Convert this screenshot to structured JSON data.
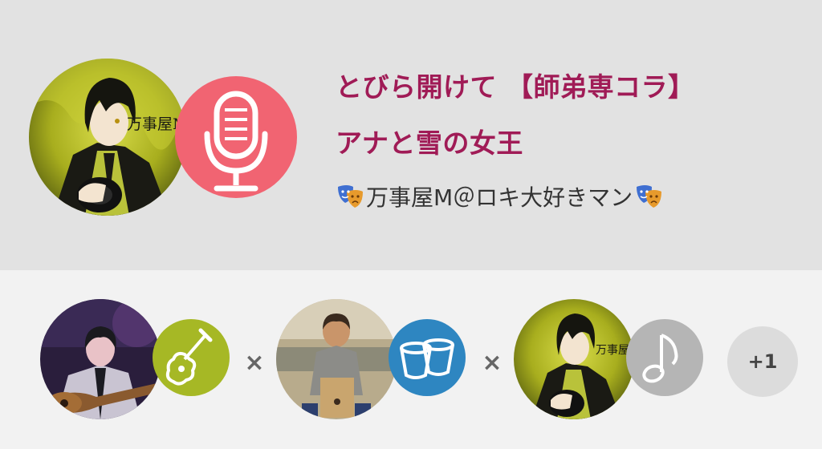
{
  "song": {
    "title_line1": "とびら開けて 【師弟専コラ】",
    "title_line2": "アナと雪の女王",
    "artist": "万事屋M＠ロキ大好きマン"
  },
  "colors": {
    "title": "#a01b56",
    "mic_badge": "#f16472",
    "guitar_badge": "#a6b825",
    "drum_badge": "#2e86c1",
    "note_badge": "#b5b5b5"
  },
  "main_avatar": {
    "caption": "万事屋M"
  },
  "collab": {
    "participants": [
      {
        "name": "guitar-player",
        "part_icon": "guitar-icon"
      },
      {
        "name": "cajon-player",
        "part_icon": "drum-icon"
      },
      {
        "name": "vocalist",
        "part_icon": "music-note-icon",
        "caption": "万事屋M"
      }
    ],
    "separator": "×",
    "more_count": "+1"
  }
}
